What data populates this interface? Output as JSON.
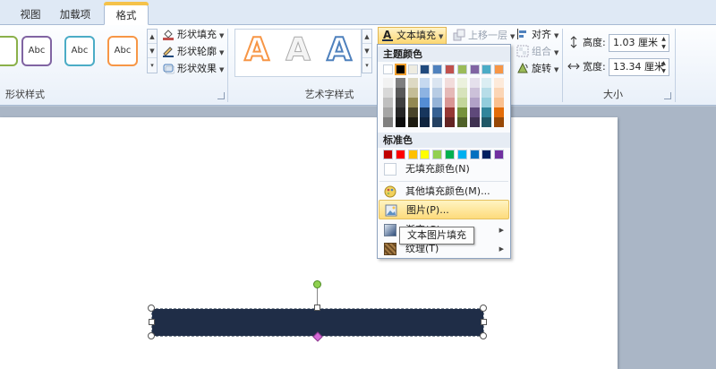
{
  "tabs": [
    "视图",
    "加载项",
    "格式"
  ],
  "ribbon": {
    "shape_styles": {
      "label": "形状样式",
      "samples": [
        "Abc",
        "Abc",
        "Abc"
      ],
      "fill": "形状填充",
      "outline": "形状轮廓",
      "effects": "形状效果"
    },
    "wordart": {
      "label": "艺术字样式",
      "samples": [
        "A",
        "A",
        "A"
      ],
      "text_fill": "文本填充"
    },
    "arrange": {
      "bring_forward": "上移一层",
      "align": "对齐",
      "group": "组合",
      "rotate": "旋转"
    },
    "size": {
      "label": "大小",
      "height_label": "高度:",
      "height_value": "1.03 厘米",
      "width_label": "宽度:",
      "width_value": "13.34 厘米"
    }
  },
  "menu": {
    "theme_colors_header": "主题颜色",
    "standard_colors_header": "标准色",
    "no_fill": "无填充颜色(N)",
    "more_colors": "其他填充颜色(M)...",
    "picture": "图片(P)...",
    "gradient": "渐变(G)",
    "texture": "纹理(T)"
  },
  "tooltip": "文本图片填充",
  "colors": {
    "shape_fill": "#1f2d47",
    "theme_top": [
      "#ffffff",
      "#000000",
      "#eeece1",
      "#1f497d",
      "#4f81bd",
      "#c0504d",
      "#9bbb59",
      "#8064a2",
      "#4bacc6",
      "#f79646"
    ],
    "theme_shades": [
      [
        "#f2f2f2",
        "#d8d8d8",
        "#bfbfbf",
        "#a5a5a5",
        "#7f7f7f"
      ],
      [
        "#7f7f7f",
        "#595959",
        "#3f3f3f",
        "#262626",
        "#0c0c0c"
      ],
      [
        "#ddd9c3",
        "#c4bd97",
        "#938953",
        "#494429",
        "#1d1b10"
      ],
      [
        "#c6d9f0",
        "#8db3e2",
        "#548dd4",
        "#17365d",
        "#0f243e"
      ],
      [
        "#dbe5f1",
        "#b8cce4",
        "#95b3d7",
        "#366092",
        "#244061"
      ],
      [
        "#f2dcdb",
        "#e5b9b7",
        "#d99694",
        "#953734",
        "#632423"
      ],
      [
        "#ebf1dd",
        "#d7e3bc",
        "#c3d69b",
        "#76923c",
        "#4f6128"
      ],
      [
        "#e5e0ec",
        "#ccc1d9",
        "#b2a2c7",
        "#5f497a",
        "#3f3151"
      ],
      [
        "#dbeef3",
        "#b7dde8",
        "#92cddc",
        "#31859b",
        "#205867"
      ],
      [
        "#fdeada",
        "#fbd5b5",
        "#fac08f",
        "#e36c09",
        "#974806"
      ]
    ],
    "standard": [
      "#c00000",
      "#ff0000",
      "#ffc000",
      "#ffff00",
      "#92d050",
      "#00b050",
      "#00b0f0",
      "#0070c0",
      "#002060",
      "#7030a0"
    ]
  }
}
